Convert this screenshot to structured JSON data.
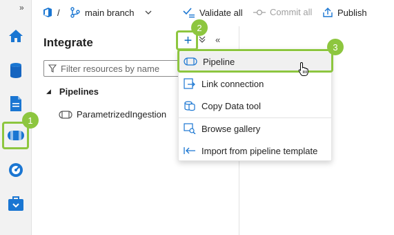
{
  "rail": {
    "expand_glyph": "»",
    "items": [
      {
        "name": "home-icon"
      },
      {
        "name": "data-icon"
      },
      {
        "name": "develop-icon"
      },
      {
        "name": "integrate-icon"
      },
      {
        "name": "monitor-icon"
      },
      {
        "name": "manage-icon"
      }
    ]
  },
  "toolbar": {
    "separator": "/",
    "branch": "main branch",
    "validate_all": "Validate all",
    "commit_all": "Commit all",
    "publish": "Publish"
  },
  "panel": {
    "title": "Integrate",
    "filter_placeholder": "Filter resources by name",
    "add_glyph": "+",
    "collapse_glyph": "≫",
    "tree": {
      "section": "Pipelines",
      "items": [
        "ParametrizedIngestion"
      ]
    }
  },
  "menu": {
    "items": [
      {
        "label": "Pipeline",
        "icon": "pipeline-icon"
      },
      {
        "label": "Link connection",
        "icon": "link-connection-icon"
      },
      {
        "label": "Copy Data tool",
        "icon": "copy-data-icon"
      },
      {
        "label": "Browse gallery",
        "icon": "gallery-icon"
      },
      {
        "label": "Import from pipeline template",
        "icon": "import-icon"
      }
    ]
  },
  "callouts": [
    "1",
    "2",
    "3"
  ],
  "colors": {
    "accent": "#0f6cbd",
    "callout": "#8dc63f",
    "rail_bg": "#f2f2f2"
  }
}
